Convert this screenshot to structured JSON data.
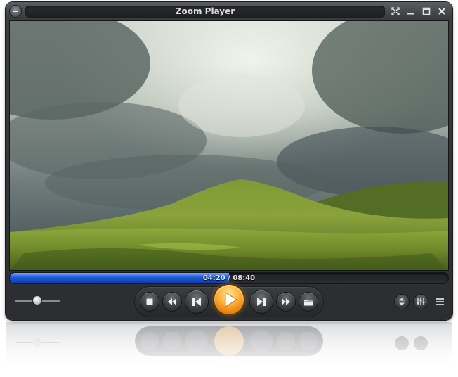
{
  "window": {
    "title": "Zoom Player",
    "menu_icon": "menu-icon",
    "controls": [
      "fullscreen-icon",
      "minimize-icon",
      "maximize-icon",
      "close-icon"
    ]
  },
  "playback": {
    "current_time": "04:20",
    "separator": " / ",
    "total_time": "08:40",
    "progress": 0.5
  },
  "volume": {
    "level": 0.5
  },
  "transport": {
    "buttons": [
      "stop-icon",
      "rewind-icon",
      "previous-icon",
      "play-icon",
      "next-icon",
      "fast-forward-icon",
      "open-folder-icon"
    ]
  },
  "right_controls": [
    "up-down-icon",
    "equalizer-icon",
    "playlist-icon"
  ],
  "colors": {
    "accent_play": "#ffb43a",
    "seek_fill": "#1c57d6",
    "frame": "#2b2d30"
  }
}
